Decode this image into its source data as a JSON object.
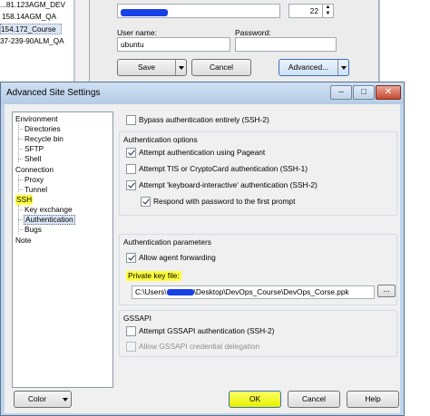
{
  "background": {
    "site_list": [
      {
        "label": "...81.123AGM_DEV",
        "selected": false
      },
      {
        "label": "158.14AGM_QA",
        "selected": false
      },
      {
        "label": "154.172_Course",
        "selected": true
      },
      {
        "label": "37-239-90ALM_QA",
        "selected": false
      }
    ],
    "port_value": "22",
    "user_name_label": "User name:",
    "user_name_value": "ubuntu",
    "password_label": "Password:",
    "password_value": "",
    "save_label": "Save",
    "cancel_label": "Cancel",
    "advanced_label": "Advanced..."
  },
  "dialog": {
    "title": "Advanced Site Settings",
    "title_buttons": {
      "minimize": "–",
      "maximize": "□",
      "close": "✕"
    },
    "tree": [
      {
        "label": "Environment",
        "depth": 0,
        "highlight": false,
        "selected": false
      },
      {
        "label": "Directories",
        "depth": 1,
        "highlight": false,
        "selected": false
      },
      {
        "label": "Recycle bin",
        "depth": 1,
        "highlight": false,
        "selected": false
      },
      {
        "label": "SFTP",
        "depth": 1,
        "highlight": false,
        "selected": false
      },
      {
        "label": "Shell",
        "depth": 1,
        "highlight": false,
        "selected": false
      },
      {
        "label": "Connection",
        "depth": 0,
        "highlight": false,
        "selected": false
      },
      {
        "label": "Proxy",
        "depth": 1,
        "highlight": false,
        "selected": false
      },
      {
        "label": "Tunnel",
        "depth": 1,
        "highlight": false,
        "selected": false
      },
      {
        "label": "SSH",
        "depth": 0,
        "highlight": true,
        "selected": false
      },
      {
        "label": "Key exchange",
        "depth": 1,
        "highlight": false,
        "selected": false
      },
      {
        "label": "Authentication",
        "depth": 1,
        "highlight": false,
        "selected": true
      },
      {
        "label": "Bugs",
        "depth": 1,
        "highlight": false,
        "selected": false
      },
      {
        "label": "Note",
        "depth": 0,
        "highlight": false,
        "selected": false
      }
    ],
    "bypass_label": "Bypass authentication entirely (SSH-2)",
    "bypass_checked": false,
    "auth_options": {
      "title": "Authentication options",
      "pageant_label": "Attempt authentication using Pageant",
      "pageant_checked": true,
      "tis_label": "Attempt TIS or CryptoCard authentication (SSH-1)",
      "tis_checked": false,
      "keyboard_label": "Attempt 'keyboard-interactive' authentication (SSH-2)",
      "keyboard_checked": true,
      "respond_label": "Respond with password to the first prompt",
      "respond_checked": true
    },
    "auth_params": {
      "title": "Authentication parameters",
      "agent_fwd_label": "Allow agent forwarding",
      "agent_fwd_checked": true,
      "private_key_label": "Private key file:",
      "private_key_prefix": "C:\\Users\\",
      "private_key_suffix": "\\Desktop\\DevOps_Course\\DevOps_Corse.ppk",
      "browse_label": "..."
    },
    "gssapi": {
      "title": "GSSAPI",
      "attempt_label": "Attempt GSSAPI authentication (SSH-2)",
      "attempt_checked": false,
      "delegation_label": "Allow GSSAPI credential delegation",
      "delegation_checked": false
    },
    "footer": {
      "color_label": "Color",
      "ok_label": "OK",
      "cancel_label": "Cancel",
      "help_label": "Help"
    }
  },
  "colors": {
    "highlight": "#ffff3c",
    "dialog_frame": "#bfd4ea",
    "redaction": "#1740e6"
  }
}
